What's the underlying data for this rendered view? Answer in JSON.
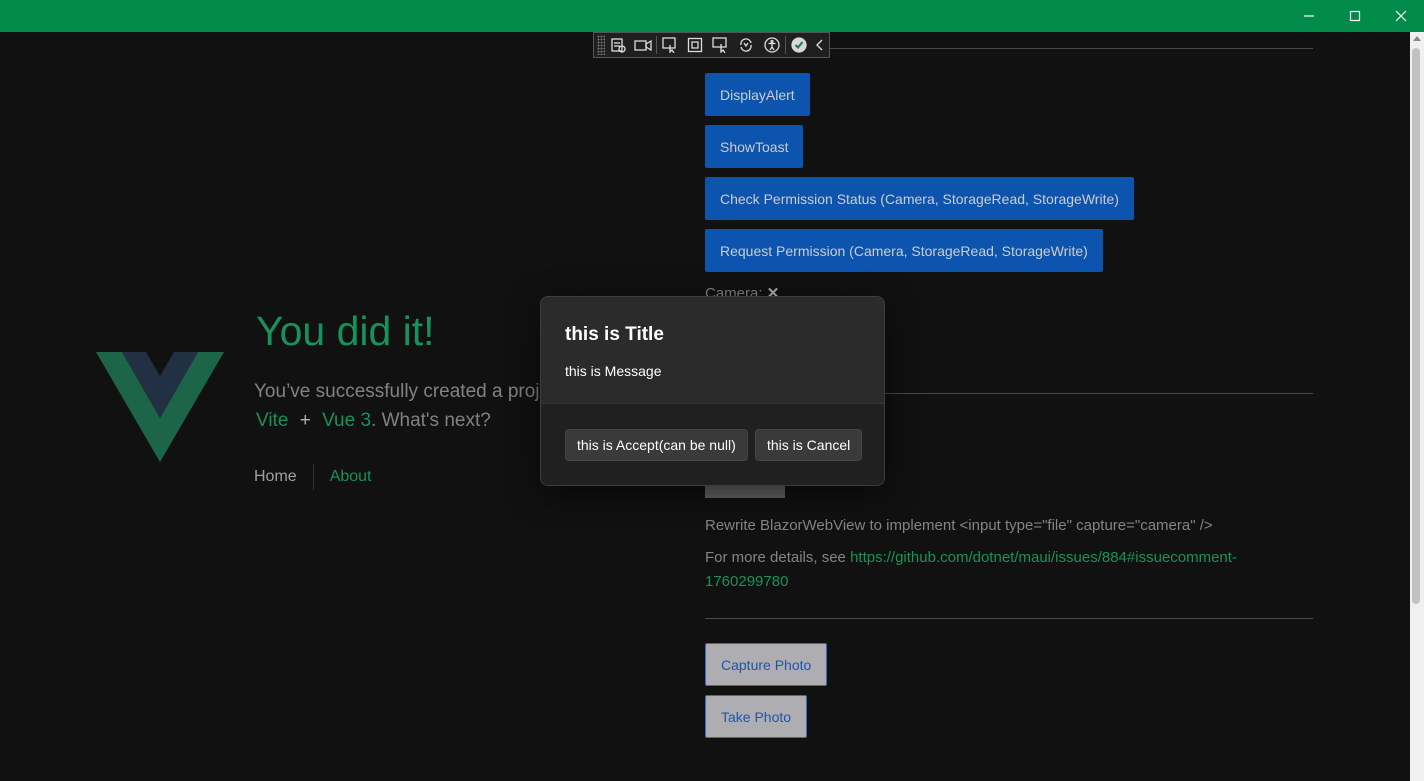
{
  "window": {
    "minimize": "minimize",
    "maximize": "maximize",
    "close": "close"
  },
  "hero": {
    "title": "You did it!",
    "sub_line1": "You’ve successfully created a proj",
    "vite": "Vite",
    "plus": "+",
    "vue": "Vue 3",
    "whats_next": ". What's next?"
  },
  "nav": {
    "home": "Home",
    "about": "About"
  },
  "buttons": {
    "display_alert": "DisplayAlert",
    "show_toast": "ShowToast",
    "check_permission": "Check Permission Status (Camera, StorageRead, StorageWrite)",
    "request_permission": "Request Permission (Camera, StorageRead, StorageWrite)",
    "capture_photo": "Capture Photo",
    "take_photo": "Take Photo"
  },
  "permission": {
    "camera_label": "Camera: ",
    "camera_status": "✕"
  },
  "notes": {
    "rewrite": "Rewrite BlazorWebView to implement <input type=\"file\" capture=\"camera\" />",
    "details_prefix": "For more details, see ",
    "details_link_1": "https://github.com/dotnet/maui/issues/884#issuecomment-",
    "details_link_2": "1760299780"
  },
  "dialog": {
    "title": "this is Title",
    "message": "this is Message",
    "accept": "this is Accept(can be null)",
    "cancel": "this is Cancel"
  },
  "colors": {
    "titlebar": "#018b4a",
    "accent": "#1a9a5f",
    "button_blue": "#0d59b7"
  }
}
